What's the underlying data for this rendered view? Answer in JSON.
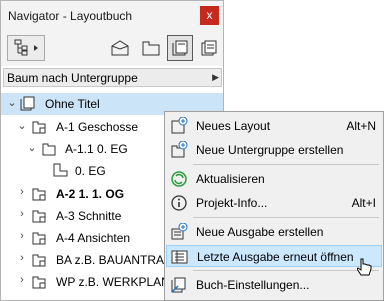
{
  "window": {
    "title": "Navigator - Layoutbuch",
    "close_glyph": "x"
  },
  "toolbar": {
    "buttons": [
      {
        "name": "project-map-icon"
      },
      {
        "name": "view-map-icon"
      },
      {
        "name": "layout-book-icon",
        "active": true
      },
      {
        "name": "publisher-sets-icon"
      }
    ]
  },
  "dropdown": {
    "label": "Baum nach Untergruppe",
    "arrow": "▶"
  },
  "tree": {
    "items": [
      {
        "label": "Ohne Titel",
        "chevron": "⌄",
        "bold": false
      },
      {
        "label": "A-1 Geschosse",
        "chevron": "⌄",
        "bold": false
      },
      {
        "label": "A-1.1 0. EG",
        "chevron": "⌄",
        "bold": false
      },
      {
        "label": "0. EG",
        "chevron": "",
        "bold": false
      },
      {
        "label": "A-2 1. 1. OG",
        "chevron": "›",
        "bold": true
      },
      {
        "label": "A-3 Schnitte",
        "chevron": "›",
        "bold": false
      },
      {
        "label": "A-4 Ansichten",
        "chevron": "›",
        "bold": false
      },
      {
        "label": "BA z.B. BAUANTRAG",
        "chevron": "›",
        "bold": false
      },
      {
        "label": "WP z.B. WERKPLANUNG",
        "chevron": "›",
        "bold": false
      }
    ]
  },
  "context_menu": {
    "items": [
      {
        "label": "Neues Layout",
        "shortcut": "Alt+N",
        "icon": "new-layout-icon"
      },
      {
        "label": "Neue Untergruppe erstellen",
        "shortcut": "",
        "icon": "new-subset-icon"
      },
      {
        "label": "Aktualisieren",
        "shortcut": "",
        "icon": "refresh-icon"
      },
      {
        "label": "Projekt-Info...",
        "shortcut": "Alt+I",
        "icon": "info-icon"
      },
      {
        "label": "Neue Ausgabe erstellen",
        "shortcut": "",
        "icon": "new-issue-icon"
      },
      {
        "label": "Letzte Ausgabe erneut öffnen",
        "shortcut": "",
        "icon": "reopen-issue-icon",
        "highlighted": true
      },
      {
        "label": "Buch-Einstellungen...",
        "shortcut": "",
        "icon": "book-settings-icon"
      }
    ]
  },
  "colors": {
    "selection": "#cce4f7",
    "menu_highlight": "#cce8ff",
    "close_button": "#c42b1c"
  }
}
